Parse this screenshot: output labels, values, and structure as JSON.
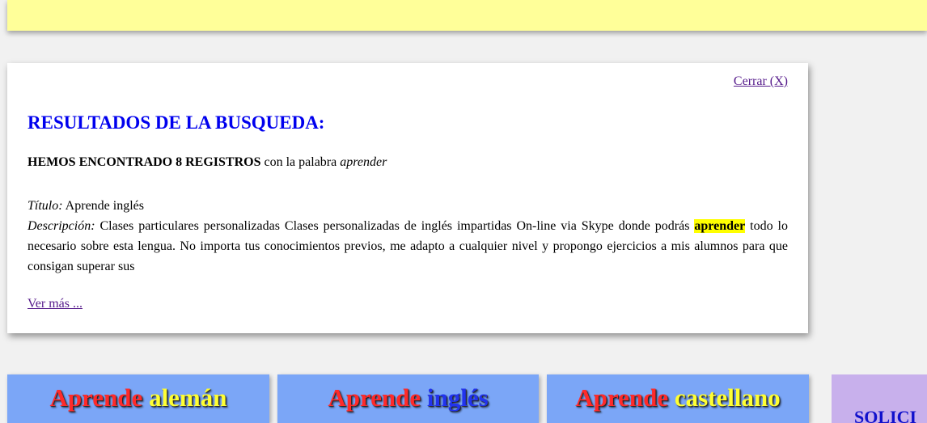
{
  "results": {
    "close_label": "Cerrar (X)",
    "title": "RESULTADOS DE LA BUSQUEDA:",
    "found_bold": "HEMOS ENCONTRADO 8 REGISTROS",
    "found_rest": " con la palabra ",
    "keyword": "aprender",
    "record": {
      "title_label": "Título:",
      "title_value": " Aprende inglés",
      "desc_label": "Descripción:",
      "desc_before": " Clases particulares personalizadas Clases personalizadas de inglés impartidas On-line via Skype donde podrás ",
      "desc_highlight": "aprender",
      "desc_after": " todo lo necesario sobre esta lengua. No importa tus conocimientos previos, me adapto a cualquier nivel y propongo ejercicios a mis alumnos para que consigan superar sus"
    },
    "more_label": "Ver más ..."
  },
  "courses": [
    {
      "word1": "Aprende",
      "word2": "alemán"
    },
    {
      "word1": "Aprende",
      "word2": "inglés"
    },
    {
      "word1": "Aprende",
      "word2": "castellano"
    }
  ],
  "solicit_label": "SOLICI",
  "colors": {
    "banner": "#ffff99",
    "course_card": "#7ba6f7",
    "solicit_card": "#c8b0ec",
    "title_blue": "#0000ee",
    "highlight": "#ffff00"
  }
}
